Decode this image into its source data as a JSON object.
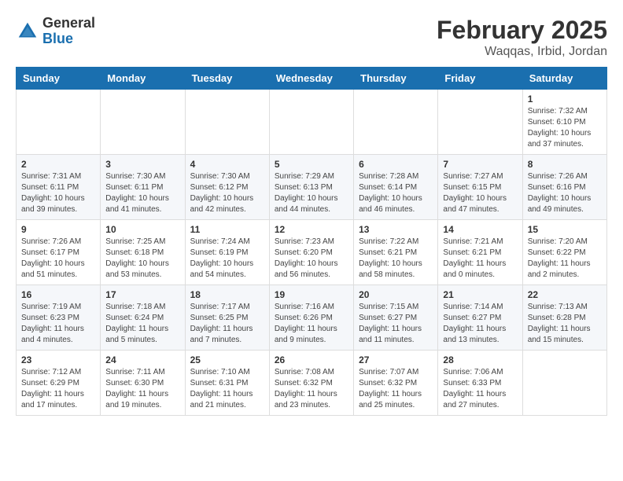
{
  "logo": {
    "general": "General",
    "blue": "Blue"
  },
  "title": "February 2025",
  "location": "Waqqas, Irbid, Jordan",
  "days_of_week": [
    "Sunday",
    "Monday",
    "Tuesday",
    "Wednesday",
    "Thursday",
    "Friday",
    "Saturday"
  ],
  "weeks": [
    [
      {
        "day": "",
        "info": ""
      },
      {
        "day": "",
        "info": ""
      },
      {
        "day": "",
        "info": ""
      },
      {
        "day": "",
        "info": ""
      },
      {
        "day": "",
        "info": ""
      },
      {
        "day": "",
        "info": ""
      },
      {
        "day": "1",
        "info": "Sunrise: 7:32 AM\nSunset: 6:10 PM\nDaylight: 10 hours\nand 37 minutes."
      }
    ],
    [
      {
        "day": "2",
        "info": "Sunrise: 7:31 AM\nSunset: 6:11 PM\nDaylight: 10 hours\nand 39 minutes."
      },
      {
        "day": "3",
        "info": "Sunrise: 7:30 AM\nSunset: 6:11 PM\nDaylight: 10 hours\nand 41 minutes."
      },
      {
        "day": "4",
        "info": "Sunrise: 7:30 AM\nSunset: 6:12 PM\nDaylight: 10 hours\nand 42 minutes."
      },
      {
        "day": "5",
        "info": "Sunrise: 7:29 AM\nSunset: 6:13 PM\nDaylight: 10 hours\nand 44 minutes."
      },
      {
        "day": "6",
        "info": "Sunrise: 7:28 AM\nSunset: 6:14 PM\nDaylight: 10 hours\nand 46 minutes."
      },
      {
        "day": "7",
        "info": "Sunrise: 7:27 AM\nSunset: 6:15 PM\nDaylight: 10 hours\nand 47 minutes."
      },
      {
        "day": "8",
        "info": "Sunrise: 7:26 AM\nSunset: 6:16 PM\nDaylight: 10 hours\nand 49 minutes."
      }
    ],
    [
      {
        "day": "9",
        "info": "Sunrise: 7:26 AM\nSunset: 6:17 PM\nDaylight: 10 hours\nand 51 minutes."
      },
      {
        "day": "10",
        "info": "Sunrise: 7:25 AM\nSunset: 6:18 PM\nDaylight: 10 hours\nand 53 minutes."
      },
      {
        "day": "11",
        "info": "Sunrise: 7:24 AM\nSunset: 6:19 PM\nDaylight: 10 hours\nand 54 minutes."
      },
      {
        "day": "12",
        "info": "Sunrise: 7:23 AM\nSunset: 6:20 PM\nDaylight: 10 hours\nand 56 minutes."
      },
      {
        "day": "13",
        "info": "Sunrise: 7:22 AM\nSunset: 6:21 PM\nDaylight: 10 hours\nand 58 minutes."
      },
      {
        "day": "14",
        "info": "Sunrise: 7:21 AM\nSunset: 6:21 PM\nDaylight: 11 hours\nand 0 minutes."
      },
      {
        "day": "15",
        "info": "Sunrise: 7:20 AM\nSunset: 6:22 PM\nDaylight: 11 hours\nand 2 minutes."
      }
    ],
    [
      {
        "day": "16",
        "info": "Sunrise: 7:19 AM\nSunset: 6:23 PM\nDaylight: 11 hours\nand 4 minutes."
      },
      {
        "day": "17",
        "info": "Sunrise: 7:18 AM\nSunset: 6:24 PM\nDaylight: 11 hours\nand 5 minutes."
      },
      {
        "day": "18",
        "info": "Sunrise: 7:17 AM\nSunset: 6:25 PM\nDaylight: 11 hours\nand 7 minutes."
      },
      {
        "day": "19",
        "info": "Sunrise: 7:16 AM\nSunset: 6:26 PM\nDaylight: 11 hours\nand 9 minutes."
      },
      {
        "day": "20",
        "info": "Sunrise: 7:15 AM\nSunset: 6:27 PM\nDaylight: 11 hours\nand 11 minutes."
      },
      {
        "day": "21",
        "info": "Sunrise: 7:14 AM\nSunset: 6:27 PM\nDaylight: 11 hours\nand 13 minutes."
      },
      {
        "day": "22",
        "info": "Sunrise: 7:13 AM\nSunset: 6:28 PM\nDaylight: 11 hours\nand 15 minutes."
      }
    ],
    [
      {
        "day": "23",
        "info": "Sunrise: 7:12 AM\nSunset: 6:29 PM\nDaylight: 11 hours\nand 17 minutes."
      },
      {
        "day": "24",
        "info": "Sunrise: 7:11 AM\nSunset: 6:30 PM\nDaylight: 11 hours\nand 19 minutes."
      },
      {
        "day": "25",
        "info": "Sunrise: 7:10 AM\nSunset: 6:31 PM\nDaylight: 11 hours\nand 21 minutes."
      },
      {
        "day": "26",
        "info": "Sunrise: 7:08 AM\nSunset: 6:32 PM\nDaylight: 11 hours\nand 23 minutes."
      },
      {
        "day": "27",
        "info": "Sunrise: 7:07 AM\nSunset: 6:32 PM\nDaylight: 11 hours\nand 25 minutes."
      },
      {
        "day": "28",
        "info": "Sunrise: 7:06 AM\nSunset: 6:33 PM\nDaylight: 11 hours\nand 27 minutes."
      },
      {
        "day": "",
        "info": ""
      }
    ]
  ]
}
